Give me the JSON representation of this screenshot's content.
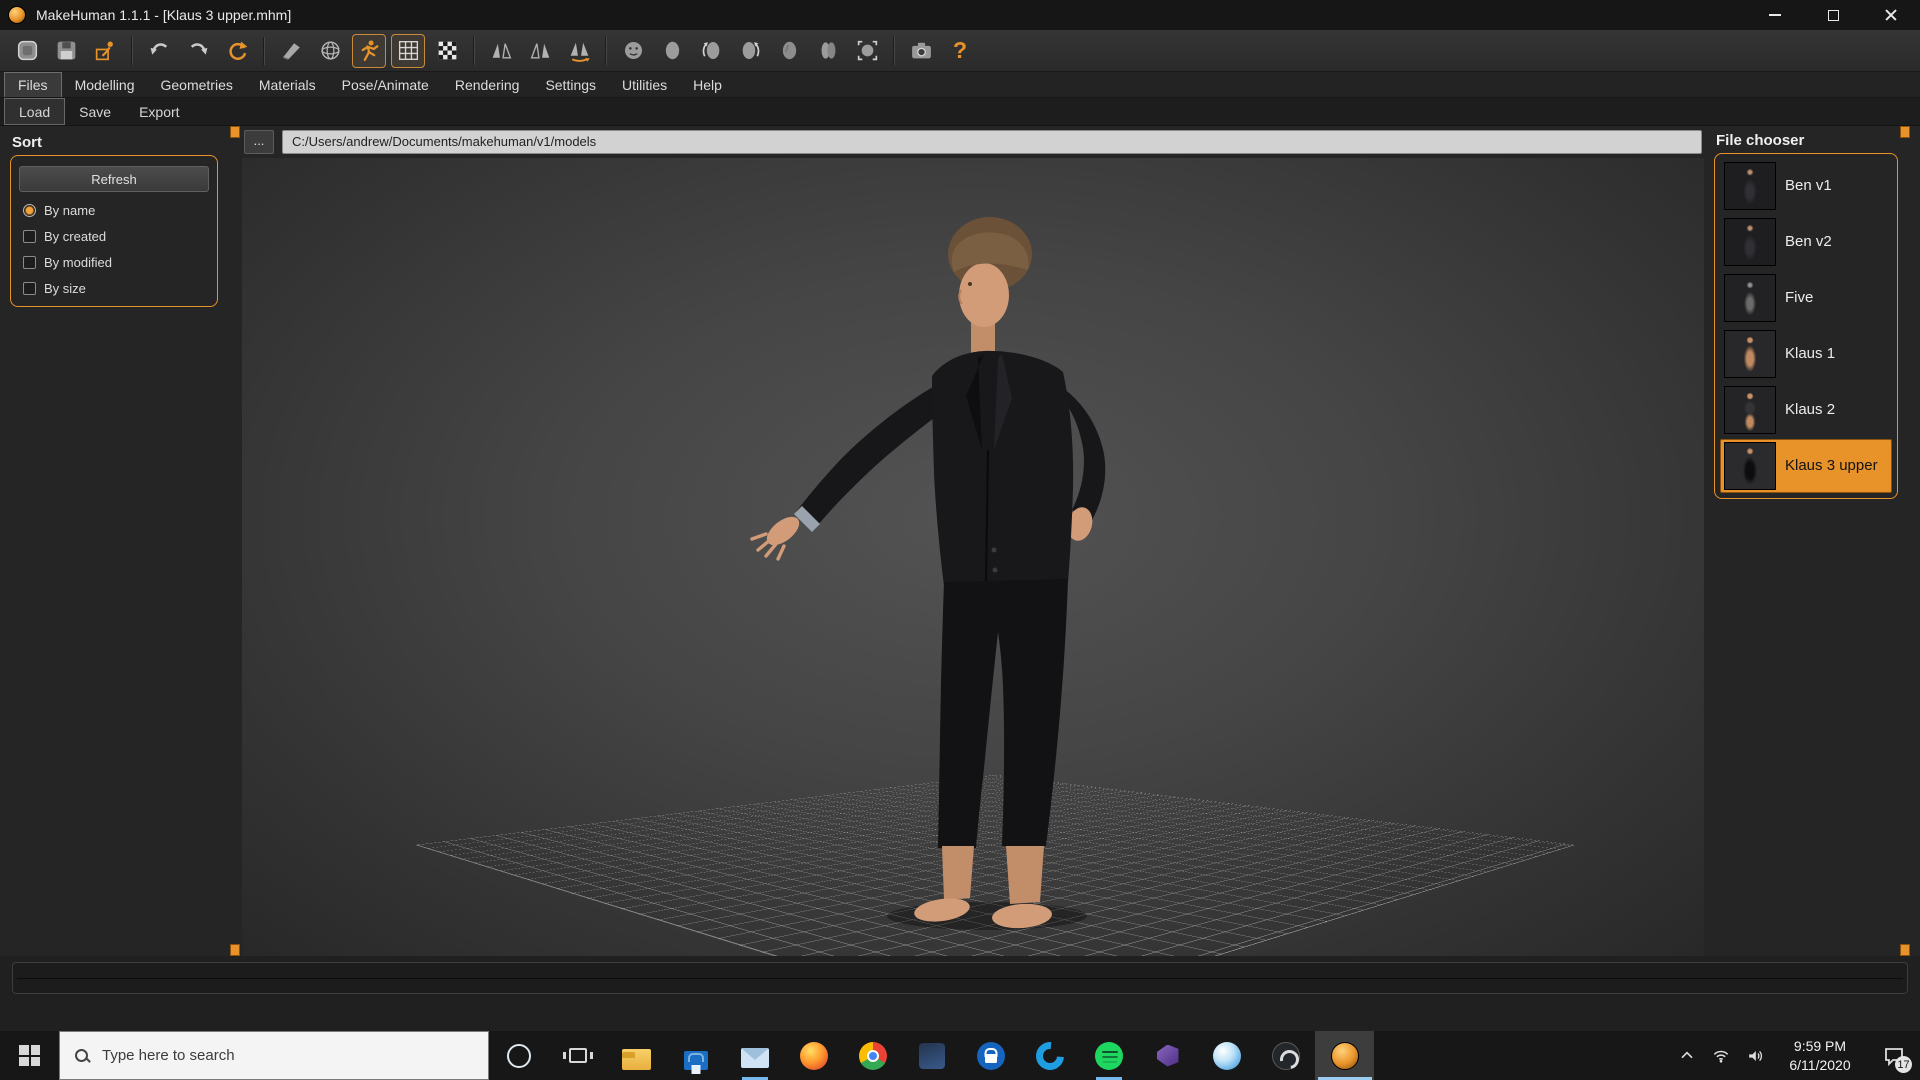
{
  "window": {
    "title": "MakeHuman 1.1.1 - [Klaus 3 upper.mhm]"
  },
  "toolbar": {
    "icons": [
      "new",
      "save",
      "load",
      "undo",
      "redo",
      "reload",
      "smooth",
      "wireframe",
      "pose",
      "grid",
      "background-checker",
      "symmetry-right",
      "symmetry-left",
      "symmetry",
      "face-view",
      "head-front-view",
      "rotate-left-view",
      "rotate-right-view",
      "head-side-view",
      "head-top-view",
      "focus-view",
      "screenshot",
      "help"
    ],
    "active_icons": [
      "pose",
      "grid"
    ],
    "help_glyph": "?"
  },
  "menu": {
    "tabs": [
      {
        "label": "Files",
        "selected": true
      },
      {
        "label": "Modelling",
        "selected": false
      },
      {
        "label": "Geometries",
        "selected": false
      },
      {
        "label": "Materials",
        "selected": false
      },
      {
        "label": "Pose/Animate",
        "selected": false
      },
      {
        "label": "Rendering",
        "selected": false
      },
      {
        "label": "Settings",
        "selected": false
      },
      {
        "label": "Utilities",
        "selected": false
      },
      {
        "label": "Help",
        "selected": false
      }
    ],
    "subtabs": [
      {
        "label": "Load",
        "selected": true
      },
      {
        "label": "Save",
        "selected": false
      },
      {
        "label": "Export",
        "selected": false
      }
    ]
  },
  "sort_panel": {
    "title": "Sort",
    "refresh_button": "Refresh",
    "options": [
      {
        "label": "By name",
        "selected": true
      },
      {
        "label": "By created",
        "selected": false
      },
      {
        "label": "By modified",
        "selected": false
      },
      {
        "label": "By size",
        "selected": false
      }
    ]
  },
  "viewport": {
    "browse_button": "...",
    "path": "C:/Users/andrew/Documents/makehuman/v1/models"
  },
  "file_chooser": {
    "title": "File chooser",
    "items": [
      {
        "name": "Ben v1",
        "selected": false
      },
      {
        "name": "Ben v2",
        "selected": false
      },
      {
        "name": "Five",
        "selected": false
      },
      {
        "name": "Klaus 1",
        "selected": false
      },
      {
        "name": "Klaus 2",
        "selected": false
      },
      {
        "name": "Klaus 3 upper",
        "selected": true
      }
    ]
  },
  "taskbar": {
    "search_placeholder": "Type here to search",
    "apps": [
      "start",
      "cortana",
      "task-view",
      "file-explorer",
      "store",
      "mail",
      "firefox",
      "chrome",
      "media-app",
      "lock-app",
      "edge",
      "spotify",
      "visual-studio",
      "globe-app",
      "obs",
      "makehuman"
    ],
    "active_app": "makehuman",
    "running_apps": [
      "mail",
      "spotify",
      "makehuman"
    ],
    "clock": {
      "time": "9:59 PM",
      "date": "6/11/2020"
    },
    "notification_count": "17"
  },
  "colors": {
    "accent_orange": "#e8922a",
    "selection_orange": "#f0a235",
    "taskbar_underline": "#76b9ed"
  }
}
